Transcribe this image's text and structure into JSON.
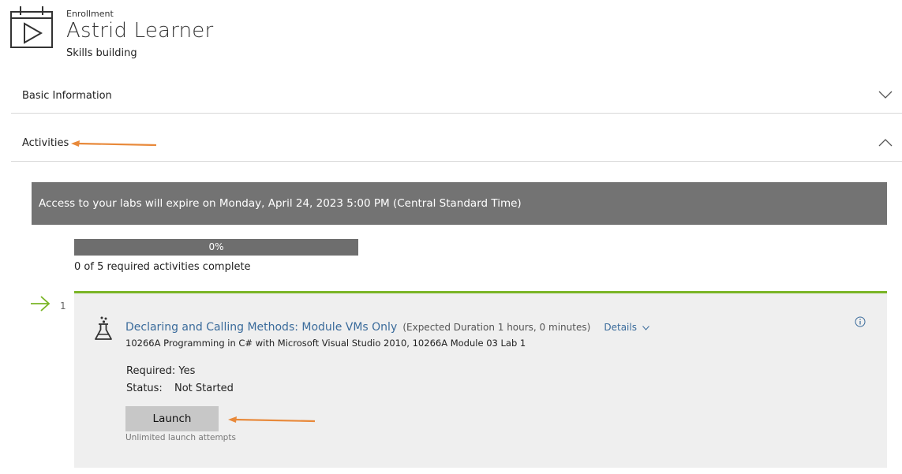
{
  "header": {
    "section_label": "Enrollment",
    "name": "Astrid Learner",
    "subtitle": "Skills building",
    "icon": "calendar-play-icon"
  },
  "accordion": [
    {
      "label": "Basic Information",
      "state": "collapsed",
      "icon": "chevron-down-icon"
    },
    {
      "label": "Activities",
      "state": "expanded",
      "icon": "chevron-up-icon"
    }
  ],
  "banner": {
    "text": "Access to your labs will expire on Monday, April 24, 2023 5:00 PM (Central Standard Time)",
    "color": "#737373"
  },
  "progress": {
    "percent_label": "0%",
    "value": 0,
    "summary": "0 of 5 required activities complete"
  },
  "activity": {
    "number": "1",
    "title": "Declaring and Calling Methods: Module VMs Only",
    "duration": "(Expected Duration 1 hours, 0 minutes)",
    "details_label": "Details",
    "course": "10266A Programming in C# with Microsoft Visual Studio 2010, 10266A Module 03 Lab 1",
    "required_text": "Required: Yes",
    "status_label": "Status:",
    "status_value": "Not Started",
    "launch_label": "Launch",
    "attempts_note": "Unlimited launch attempts",
    "accent_color": "#7ab526",
    "link_color": "#3a6b9b"
  },
  "annotations": {
    "arrow_color": "#e8893a"
  }
}
